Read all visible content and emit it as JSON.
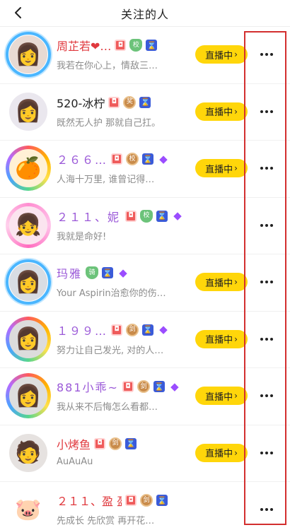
{
  "header": {
    "title": "关注的人",
    "back_icon": "chevron-left-icon"
  },
  "live_label": "直播中",
  "more_icon": "more-horizontal-icon",
  "highlight_color": "#d32f2f",
  "rows": [
    {
      "name": "周芷若❤…",
      "name_color": "red",
      "sub": "我若在你心上，情敌三…",
      "frame": "blue",
      "avatar_emoji": "👩",
      "avatar_bg": "#e8dad3",
      "badges": [
        "chat",
        "shield",
        "fan"
      ],
      "badge_texts": [
        "◘",
        "校",
        "⌛"
      ],
      "live": true
    },
    {
      "name": "520-冰柠",
      "name_color": "black",
      "sub": "既然无人护 那就自己扛。",
      "frame": "none",
      "avatar_emoji": "👩",
      "avatar_bg": "#eae7ee",
      "badges": [
        "chat",
        "medal",
        "fan"
      ],
      "badge_texts": [
        "◘",
        "奖",
        "⌛"
      ],
      "live": true
    },
    {
      "name": "２６６…",
      "name_color": "purple",
      "sub": "人海十万里, 谁曾记得…",
      "frame": "rainbow",
      "avatar_emoji": "🍊",
      "avatar_bg": "#fff1d6",
      "badges": [
        "chat",
        "medal",
        "fan",
        "gem"
      ],
      "badge_texts": [
        "◘",
        "校",
        "⌛",
        "◆"
      ],
      "live": true
    },
    {
      "name": "２１１、妮  妮❤️",
      "name_color": "purple",
      "sub": "我就是命好!",
      "frame": "pink",
      "avatar_emoji": "👧",
      "avatar_bg": "#fbe4ef",
      "badges": [
        "chat",
        "shield",
        "fan",
        "gem"
      ],
      "badge_texts": [
        "◘",
        "校",
        "⌛",
        "◆"
      ],
      "live": false
    },
    {
      "name": "玛雅",
      "name_color": "purple",
      "sub": "Your Aspirin治愈你的伤…",
      "frame": "blue",
      "avatar_emoji": "👩",
      "avatar_bg": "#d9dde3",
      "badges": [
        "shield",
        "fan",
        "gem"
      ],
      "badge_texts": [
        "骑",
        "⌛",
        "◆"
      ],
      "live": true
    },
    {
      "name": "１９９…",
      "name_color": "purple",
      "sub": "努力让自己发光, 对的人…",
      "frame": "rainbow",
      "avatar_emoji": "👩",
      "avatar_bg": "#dcdcdc",
      "badges": [
        "chat",
        "medal",
        "fan",
        "gem"
      ],
      "badge_texts": [
        "◘",
        "剑",
        "⌛",
        "◆"
      ],
      "live": true
    },
    {
      "name": "881小乖~",
      "name_color": "purple",
      "sub": "我从来不后悔怎么看都…",
      "frame": "rainbow",
      "avatar_emoji": "👩",
      "avatar_bg": "#dedede",
      "badges": [
        "chat",
        "medal",
        "fan",
        "gem"
      ],
      "badge_texts": [
        "◘",
        "剑",
        "⌛",
        "◆"
      ],
      "live": true
    },
    {
      "name": "小烤鱼",
      "name_color": "red",
      "sub": "AuAuAu",
      "frame": "none",
      "avatar_emoji": "🧑",
      "avatar_bg": "#e6e2e0",
      "badges": [
        "chat",
        "medal",
        "fan"
      ],
      "badge_texts": [
        "◘",
        "剑",
        "⌛"
      ],
      "live": true
    },
    {
      "name": "２１１、盈  盈",
      "name_color": "red",
      "sub": "先成长 先欣赏 再开花…",
      "frame": "none",
      "avatar_emoji": "🐷",
      "avatar_bg": "#ffffff",
      "badges": [
        "chat",
        "medal",
        "fan"
      ],
      "badge_texts": [
        "◘",
        "剑",
        "⌛"
      ],
      "live": false
    }
  ]
}
